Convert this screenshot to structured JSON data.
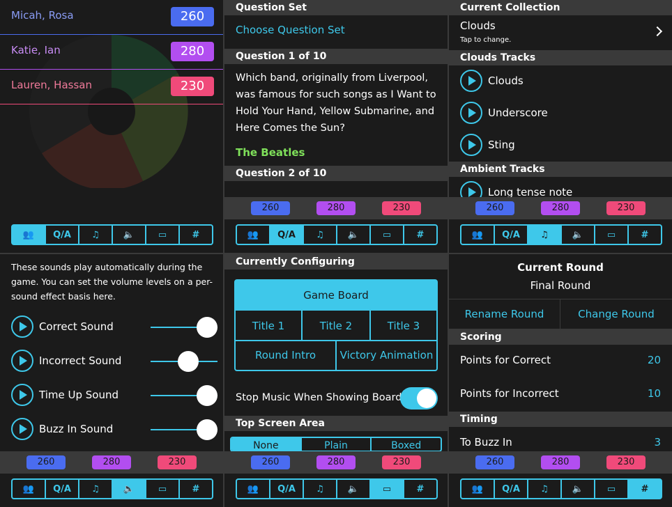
{
  "colors": {
    "accent": "#3ec8ea",
    "team1": "#4a6cf0",
    "team2": "#b24ef0",
    "team3": "#f04a7a",
    "answer": "#7fe05a"
  },
  "tabs": [
    "people-icon",
    "Q/A",
    "music-icon",
    "speaker-icon",
    "screen-icon",
    "#"
  ],
  "scores": [
    "260",
    "280",
    "230"
  ],
  "panel1": {
    "teams": [
      {
        "name": "Micah, Rosa",
        "score": "260"
      },
      {
        "name": "Katie, Ian",
        "score": "280"
      },
      {
        "name": "Lauren, Hassan",
        "score": "230"
      }
    ]
  },
  "panel2": {
    "h_set": "Question Set",
    "choose": "Choose Question Set",
    "h_q1": "Question 1 of 10",
    "q1_text": "Which band, originally from Liverpool, was famous for such songs as I Want to Hold Your Hand, Yellow Submarine, and Here Comes the Sun?",
    "q1_answer": "The Beatles",
    "h_q2": "Question 2 of 10"
  },
  "panel3": {
    "h_collection": "Current Collection",
    "collection": "Clouds",
    "tap": "Tap to change.",
    "h_tracks": "Clouds Tracks",
    "tracks": [
      "Clouds",
      "Underscore",
      "Sting"
    ],
    "h_ambient": "Ambient Tracks",
    "ambient": [
      "Long tense note"
    ]
  },
  "panel4": {
    "intro": "These sounds play automatically during the game. You can set the volume levels on a per-sound effect basis here.",
    "sounds": [
      {
        "label": "Correct Sound",
        "level": 1.0
      },
      {
        "label": "Incorrect Sound",
        "level": 0.72
      },
      {
        "label": "Time Up Sound",
        "level": 1.0
      },
      {
        "label": "Buzz In Sound",
        "level": 1.0
      }
    ]
  },
  "panel5": {
    "h_config": "Currently Configuring",
    "game_board": "Game Board",
    "titles": [
      "Title 1",
      "Title 2",
      "Title 3"
    ],
    "round_intro": "Round Intro",
    "victory": "Victory Animation",
    "stop_music": "Stop Music When Showing Board",
    "h_top": "Top Screen Area",
    "top_options": [
      "None",
      "Plain",
      "Boxed"
    ]
  },
  "panel6": {
    "h_round": "Current Round",
    "round_name": "Final Round",
    "rename": "Rename Round",
    "change": "Change Round",
    "h_scoring": "Scoring",
    "correct_label": "Points for Correct",
    "correct_val": "20",
    "incorrect_label": "Points for Incorrect",
    "incorrect_val": "10",
    "h_timing": "Timing",
    "buzz_label": "To Buzz In",
    "buzz_val": "3"
  }
}
